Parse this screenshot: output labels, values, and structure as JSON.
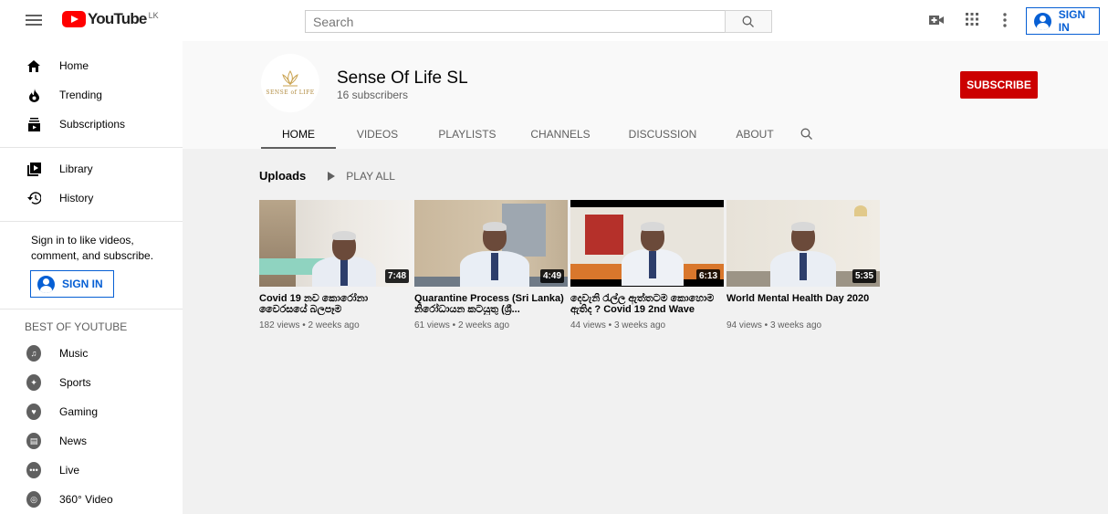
{
  "masthead": {
    "logo_text": "YouTube",
    "country": "LK",
    "search_placeholder": "Search",
    "signin_label": "SIGN IN"
  },
  "sidebar": {
    "primary": [
      {
        "label": "Home",
        "icon": "home-icon"
      },
      {
        "label": "Trending",
        "icon": "trending-icon"
      },
      {
        "label": "Subscriptions",
        "icon": "subscriptions-icon"
      }
    ],
    "secondary": [
      {
        "label": "Library",
        "icon": "library-icon"
      },
      {
        "label": "History",
        "icon": "history-icon"
      }
    ],
    "signin_prompt": "Sign in to like videos, comment, and subscribe.",
    "signin_label": "SIGN IN",
    "best_of_heading": "BEST OF YOUTUBE",
    "categories": [
      {
        "label": "Music",
        "icon": "music-icon"
      },
      {
        "label": "Sports",
        "icon": "sports-icon"
      },
      {
        "label": "Gaming",
        "icon": "gaming-icon"
      },
      {
        "label": "News",
        "icon": "news-icon"
      },
      {
        "label": "Live",
        "icon": "live-icon"
      },
      {
        "label": "360° Video",
        "icon": "360-video-icon"
      }
    ]
  },
  "channel": {
    "name": "Sense Of Life SL",
    "subscribers": "16 subscribers",
    "logo_text": "SENSE of LIFE",
    "subscribe_label": "SUBSCRIBE",
    "tabs": [
      "HOME",
      "VIDEOS",
      "PLAYLISTS",
      "CHANNELS",
      "DISCUSSION",
      "ABOUT"
    ],
    "active_tab": "HOME"
  },
  "uploads": {
    "title": "Uploads",
    "play_all": "PLAY ALL",
    "videos": [
      {
        "title": "Covid 19 නව කොරෝනා වෛරසයේ බලපෑම",
        "duration": "7:48",
        "meta": "182 views • 2 weeks ago"
      },
      {
        "title": "Quarantine Process (Sri Lanka) නිරෝධායන කටයුතු (ශ්‍රී...",
        "duration": "4:49",
        "meta": "61 views • 2 weeks ago"
      },
      {
        "title": "දෙවැනි රැල්ල ඇත්තටම කොහොම ඇතිද ? Covid 19 2nd Wave",
        "duration": "6:13",
        "meta": "44 views • 3 weeks ago"
      },
      {
        "title": "World Mental Health Day 2020",
        "duration": "5:35",
        "meta": "94 views • 3 weeks ago"
      }
    ]
  },
  "colors": {
    "accent_blue": "#065fd4",
    "subscribe_red": "#cc0000",
    "logo_red": "#ff0000"
  }
}
